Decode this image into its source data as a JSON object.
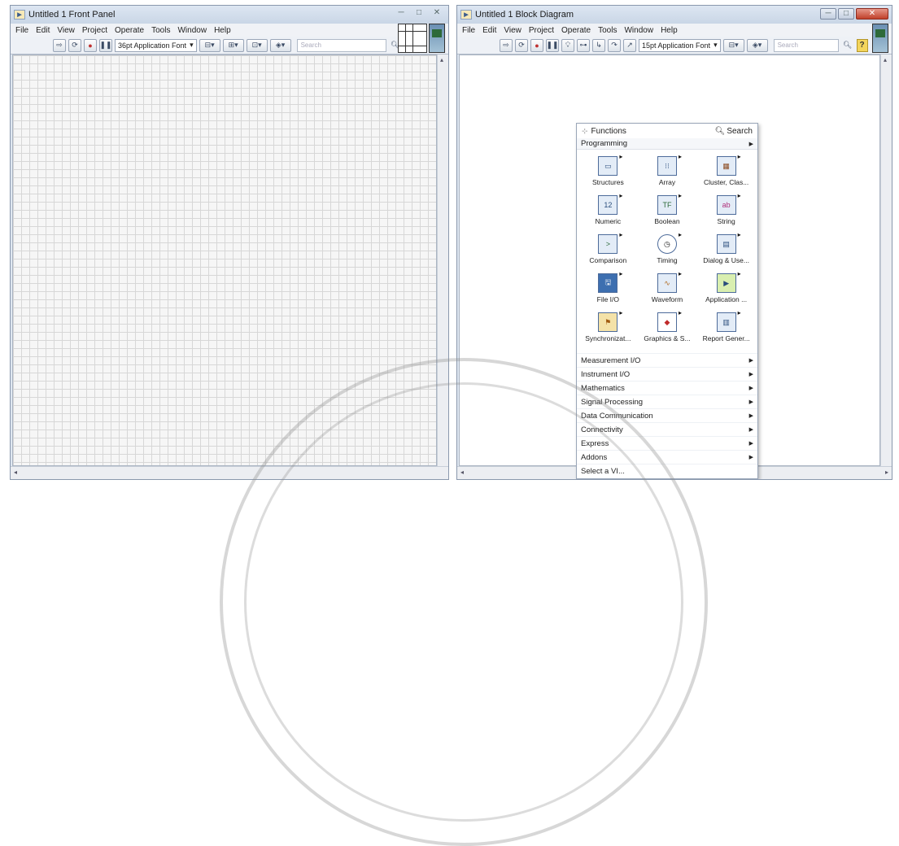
{
  "front_panel": {
    "title": "Untitled 1 Front Panel",
    "menu": [
      "File",
      "Edit",
      "View",
      "Project",
      "Operate",
      "Tools",
      "Window",
      "Help"
    ],
    "font_label": "36pt Application Font",
    "search_placeholder": "Search",
    "help_label": "?"
  },
  "block_diagram": {
    "title": "Untitled 1 Block Diagram",
    "menu": [
      "File",
      "Edit",
      "View",
      "Project",
      "Operate",
      "Tools",
      "Window",
      "Help"
    ],
    "font_label": "15pt Application Font",
    "search_placeholder": "Search",
    "help_label": "?"
  },
  "functions_palette": {
    "title": "Functions",
    "search_label": "Search",
    "category": "Programming",
    "items": [
      {
        "label": "Structures",
        "icon": "structures-icon"
      },
      {
        "label": "Array",
        "icon": "array-icon"
      },
      {
        "label": "Cluster, Clas...",
        "icon": "cluster-icon"
      },
      {
        "label": "Numeric",
        "icon": "numeric-icon"
      },
      {
        "label": "Boolean",
        "icon": "boolean-icon"
      },
      {
        "label": "String",
        "icon": "string-icon"
      },
      {
        "label": "Comparison",
        "icon": "comparison-icon"
      },
      {
        "label": "Timing",
        "icon": "timing-icon"
      },
      {
        "label": "Dialog & Use...",
        "icon": "dialog-icon"
      },
      {
        "label": "File I/O",
        "icon": "file-io-icon"
      },
      {
        "label": "Waveform",
        "icon": "waveform-icon"
      },
      {
        "label": "Application ...",
        "icon": "application-icon"
      },
      {
        "label": "Synchronizat...",
        "icon": "synchronization-icon"
      },
      {
        "label": "Graphics & S...",
        "icon": "graphics-icon"
      },
      {
        "label": "Report Gener...",
        "icon": "report-icon"
      }
    ],
    "subpalettes": [
      "Measurement I/O",
      "Instrument I/O",
      "Mathematics",
      "Signal Processing",
      "Data Communication",
      "Connectivity",
      "Express",
      "Addons",
      "Select a VI..."
    ]
  }
}
